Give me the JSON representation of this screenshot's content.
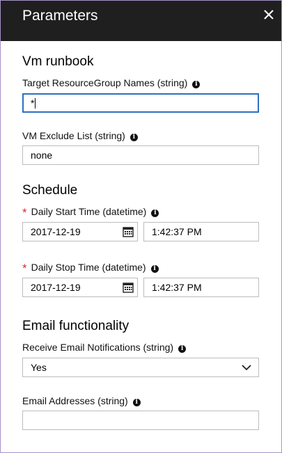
{
  "header": {
    "title": "Parameters",
    "close_label": "✕"
  },
  "vm_runbook": {
    "title": "Vm runbook",
    "target_rg": {
      "label": "Target ResourceGroup Names (string)",
      "value": "*"
    },
    "exclude_list": {
      "label": "VM Exclude List (string)",
      "value": "none"
    }
  },
  "schedule": {
    "title": "Schedule",
    "start": {
      "label": "Daily Start Time (datetime)",
      "date": "2017-12-19",
      "time": "1:42:37 PM",
      "required_mark": "*"
    },
    "stop": {
      "label": "Daily Stop Time (datetime)",
      "date": "2017-12-19",
      "time": "1:42:37 PM",
      "required_mark": "*"
    }
  },
  "email": {
    "title": "Email functionality",
    "notifications": {
      "label": "Receive Email Notifications (string)",
      "selected": "Yes"
    },
    "addresses": {
      "label": "Email Addresses (string)",
      "value": ""
    }
  },
  "icons": {
    "info": "i"
  },
  "colors": {
    "header_bg": "#1f1f1f",
    "focus_border": "#2d6fc0",
    "required": "#d82e2e",
    "panel_border": "#a594c8"
  }
}
